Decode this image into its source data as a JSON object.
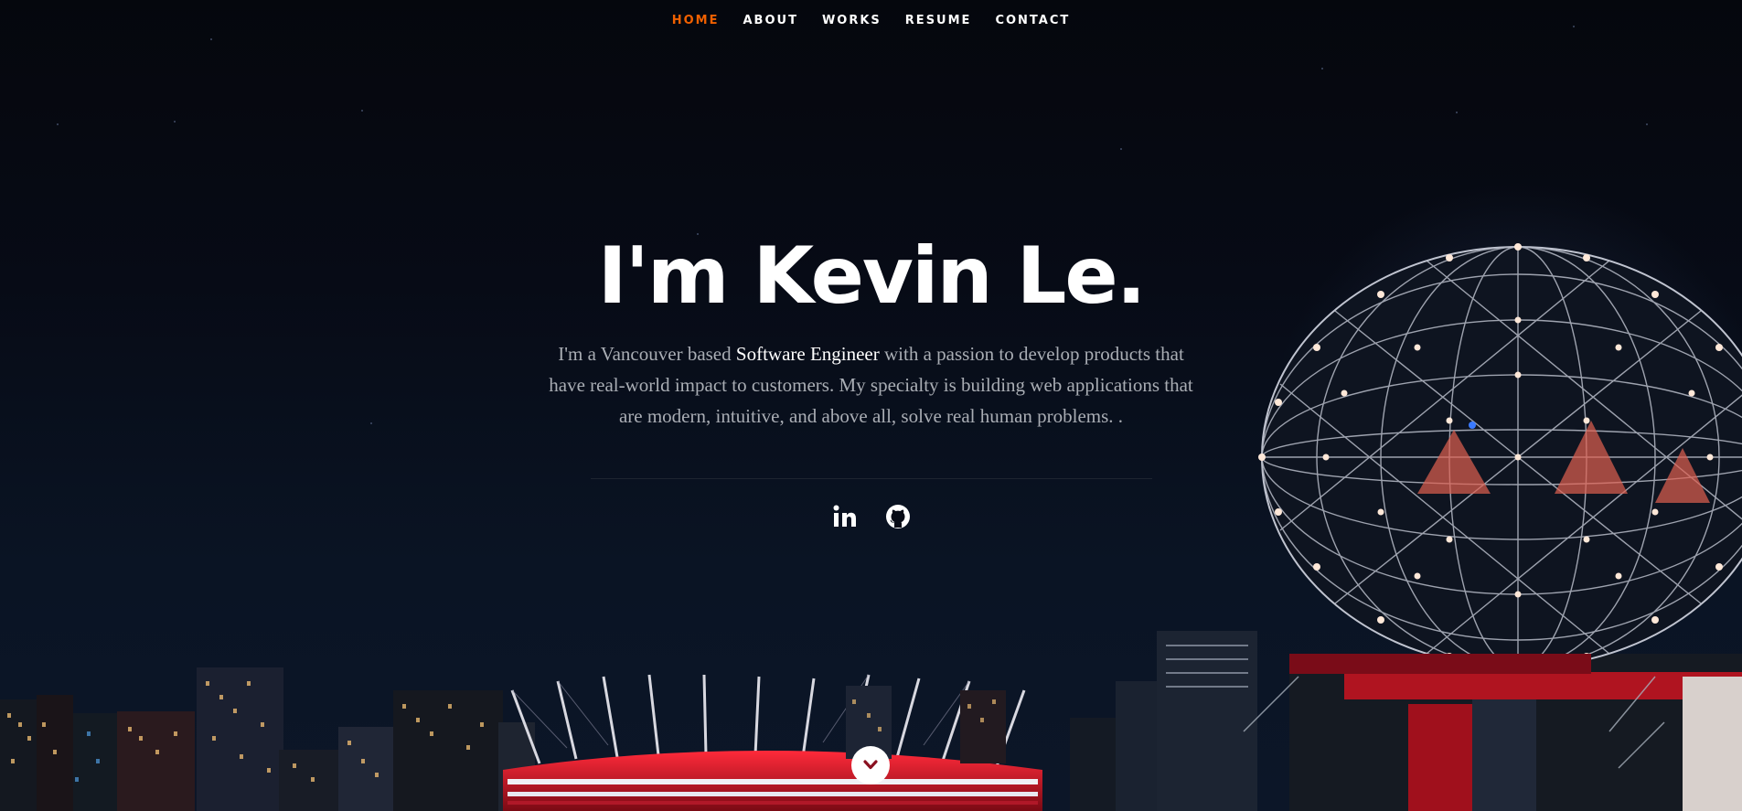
{
  "nav": {
    "items": [
      {
        "label": "HOME",
        "active": true
      },
      {
        "label": "ABOUT",
        "active": false
      },
      {
        "label": "WORKS",
        "active": false
      },
      {
        "label": "RESUME",
        "active": false
      },
      {
        "label": "CONTACT",
        "active": false
      }
    ]
  },
  "hero": {
    "title": "I'm Kevin Le.",
    "desc_before": "I'm a Vancouver based ",
    "desc_highlight": "Software Engineer",
    "desc_after": " with a passion to develop products that have real-world impact to customers. My specialty is building web applications that are modern, intuitive, and above all, solve real human problems. ."
  },
  "social": {
    "icons": [
      "linkedin-icon",
      "github-icon"
    ]
  },
  "scroll": {
    "icon": "chevron-down-icon"
  },
  "colors": {
    "accent": "#f06000",
    "background": "#070b16",
    "text": "#ffffff",
    "muted_text": "#a9adb4"
  }
}
